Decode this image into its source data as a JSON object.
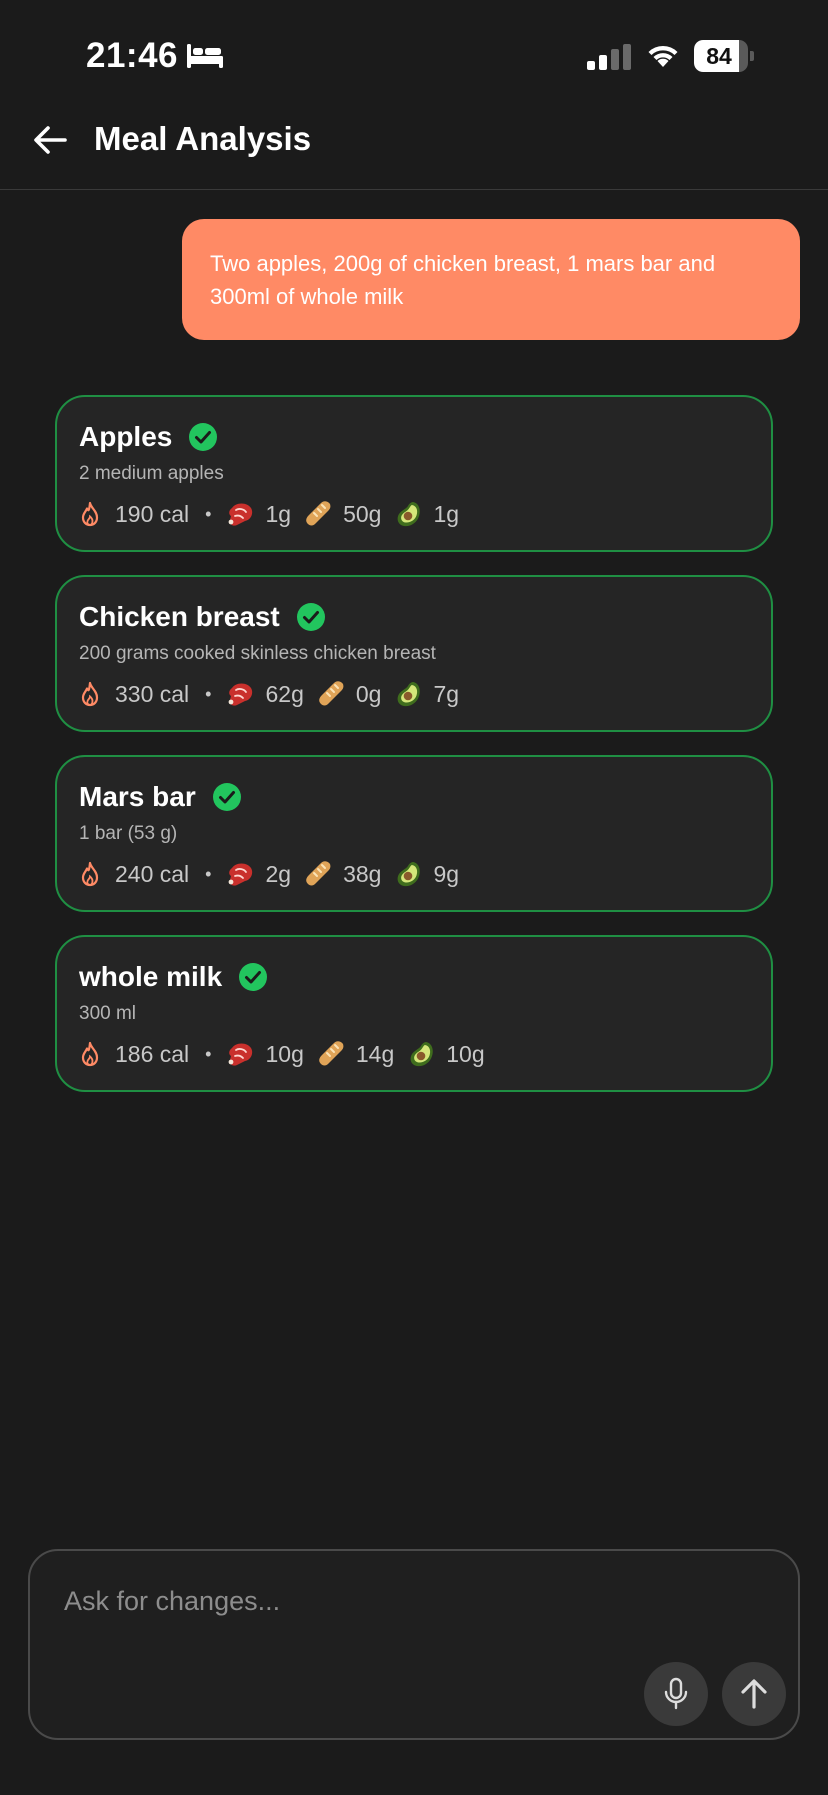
{
  "status_bar": {
    "time": "21:46",
    "battery_level": "84",
    "battery_fraction": 0.84
  },
  "header": {
    "title": "Meal Analysis"
  },
  "chat": {
    "user_message": "Two apples, 200g of chicken breast, 1 mars bar and 300ml of whole milk"
  },
  "foods": [
    {
      "name": "Apples",
      "description": "2 medium apples",
      "calories": "190 cal",
      "protein": "1g",
      "carbs": "50g",
      "fat": "1g"
    },
    {
      "name": "Chicken breast",
      "description": "200 grams cooked skinless chicken breast",
      "calories": "330 cal",
      "protein": "62g",
      "carbs": "0g",
      "fat": "7g"
    },
    {
      "name": "Mars bar",
      "description": "1 bar (53 g)",
      "calories": "240 cal",
      "protein": "2g",
      "carbs": "38g",
      "fat": "9g"
    },
    {
      "name": "whole milk",
      "description": "300 ml",
      "calories": "186 cal",
      "protein": "10g",
      "carbs": "14g",
      "fat": "10g"
    }
  ],
  "input": {
    "placeholder": "Ask for changes..."
  },
  "colors": {
    "background": "#1b1b1b",
    "bubble": "#ff8a65",
    "card_border": "#1f8f43",
    "check": "#22c55e",
    "flame": "#ff8a65"
  },
  "icons": {
    "back": "arrow-left-icon",
    "verified": "check-circle-icon",
    "calories": "flame-icon",
    "protein": "meat-icon",
    "carbs": "bread-icon",
    "fat": "avocado-icon",
    "mic": "microphone-icon",
    "send": "arrow-up-icon"
  }
}
